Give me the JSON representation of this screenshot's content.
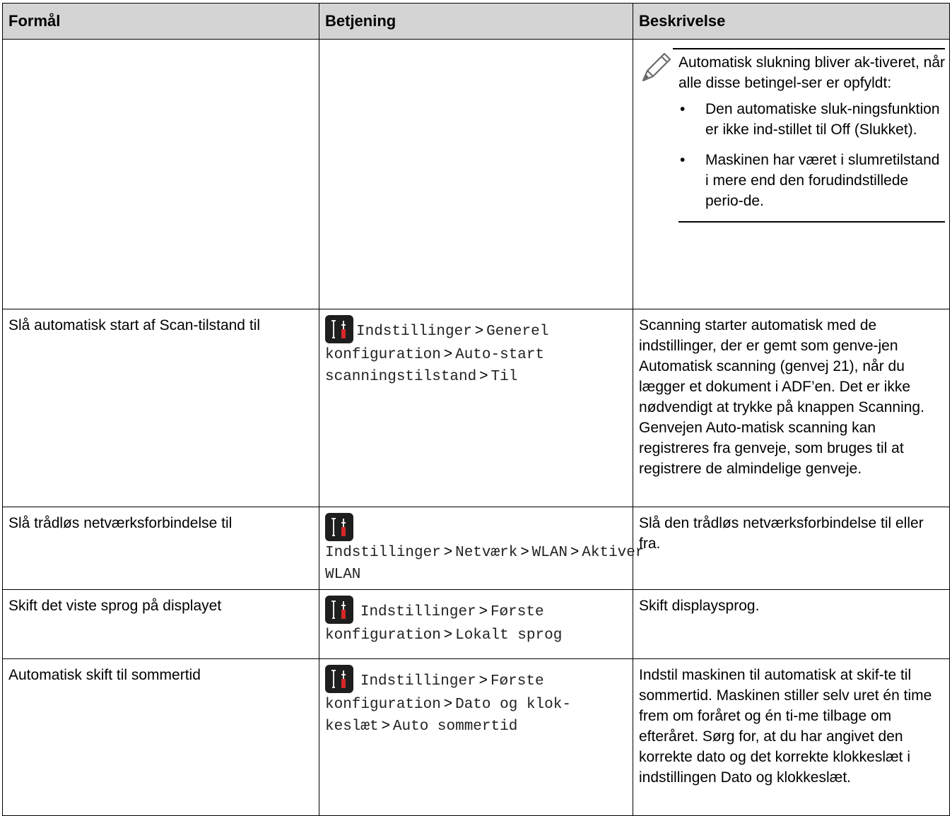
{
  "headers": [
    "Formål",
    "Betjening",
    "Beskrivelse"
  ],
  "note": {
    "icon": "pencil-note-icon",
    "text": "Automatisk slukning bliver ak-tiveret, når alle disse betingel-ser er opfyldt:",
    "bullets": [
      "Den automatiske sluk-ningsfunktion er ikke ind-stillet til Off (Slukket).",
      "Maskinen har været i slumretilstand i mere end den forudindstillede perio-de."
    ]
  },
  "rows": [
    {
      "purpose": "Slå automatisk start af Scan-tilstand til",
      "menu_icon": "settings-tools-icon",
      "path": [
        "Indstillinger",
        "Generel konfiguration",
        "Auto-start scanningstilstand",
        "Til"
      ],
      "description": "Scanning starter automatisk med de indstillinger, der er gemt som genve-jen Automatisk scanning (genvej 21), når du lægger et dokument i ADF’en. Det er ikke nødvendigt at trykke på knappen Scanning. Genvejen Auto-matisk scanning kan registreres fra genveje, som bruges til at registrere de almindelige genveje."
    },
    {
      "purpose": "Slå trådløs netværksforbindelse til",
      "menu_icon": "settings-tools-icon",
      "path": [
        "Indstillinger",
        "Netværk",
        "WLAN",
        "Aktiver WLAN"
      ],
      "description": "Slå den trådløs netværksforbindelse til eller fra."
    },
    {
      "purpose": "Skift det viste sprog på displayet",
      "menu_icon": "settings-tools-icon",
      "path": [
        "Indstillinger",
        "Første konfiguration",
        "Lokalt sprog"
      ],
      "description": "Skift displaysprog."
    },
    {
      "purpose": "Automatisk skift til sommertid",
      "menu_icon": "settings-tools-icon",
      "path": [
        "Indstillinger",
        "Første konfiguration",
        "Dato og klok-keslæt",
        "Auto sommertid"
      ],
      "description": "Indstil maskinen til automatisk at skif-te til sommertid. Maskinen stiller selv uret én time frem om foråret og én ti-me tilbage om efteråret. Sørg for, at du har angivet den korrekte dato og det korrekte klokkeslæt i indstillingen Dato og klokkeslæt."
    }
  ]
}
